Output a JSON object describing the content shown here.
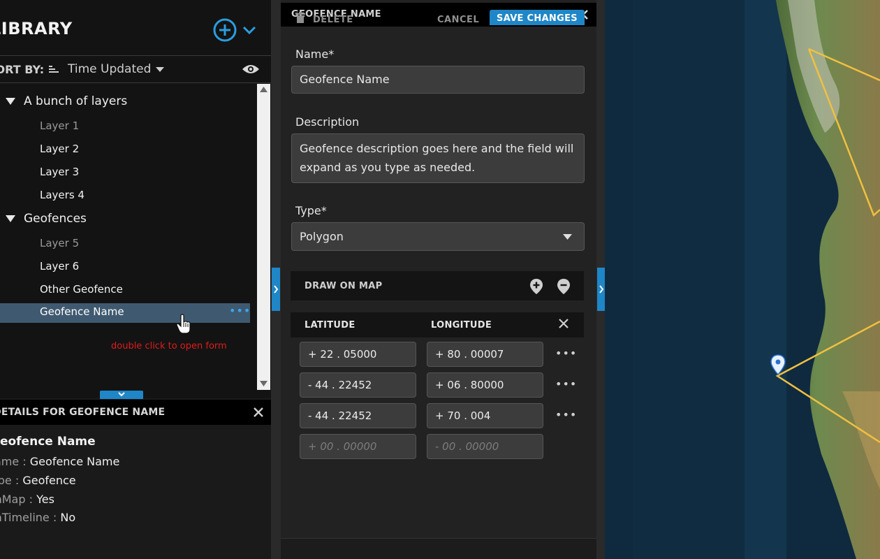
{
  "library": {
    "title": "LIBRARY",
    "sort_label": "SORT BY:",
    "sort_value": "Time Updated",
    "groups": [
      {
        "label": "A bunch of layers",
        "items": [
          "Layer 1",
          "Layer 2",
          "Layer 3",
          "Layers 4"
        ]
      },
      {
        "label": "Geofences",
        "items": [
          "Layer 5",
          "Layer 6",
          "Other Geofence"
        ]
      }
    ],
    "selected_item": "Geofence Name",
    "selected_more": "•••",
    "hint": "double click to open form"
  },
  "details": {
    "title": "DETAILS FOR GEOFENCE NAME",
    "name": "Geofence Name",
    "rows": [
      {
        "key": "Name :",
        "value": "Geofence Name"
      },
      {
        "key": "Type :",
        "value": "Geofence"
      },
      {
        "key": "OnMap :",
        "value": "Yes"
      },
      {
        "key": "OnTimeline :",
        "value": "No"
      }
    ]
  },
  "form": {
    "title": "GEOFENCE NAME",
    "name_label": "Name*",
    "name_value": "Geofence Name",
    "description_label": "Description",
    "description_value": "Geofence description goes here and the field will expand as you type as needed.",
    "type_label": "Type*",
    "type_value": "Polygon",
    "draw_label": "DRAW ON MAP",
    "lat_header": "LATITUDE",
    "lon_header": "LONGITUDE",
    "coords": [
      {
        "lat": "+ 22 . 05000",
        "lon": "+ 80 . 00007"
      },
      {
        "lat": "- 44 . 22452",
        "lon": "+ 06 . 80000"
      },
      {
        "lat": "- 44 . 22452",
        "lon": "+ 70 . 004"
      }
    ],
    "lat_placeholder": "+ 00 . 00000",
    "lon_placeholder": "- 00 . 00000",
    "more_glyph": "•••",
    "delete_label": "DELETE",
    "cancel_label": "CANCEL",
    "save_label": "SAVE CHANGES"
  },
  "colors": {
    "accent": "#1f86c7",
    "selected_row": "#3f5a70",
    "hint": "#e01b1b",
    "polygon": "#f0c040"
  }
}
